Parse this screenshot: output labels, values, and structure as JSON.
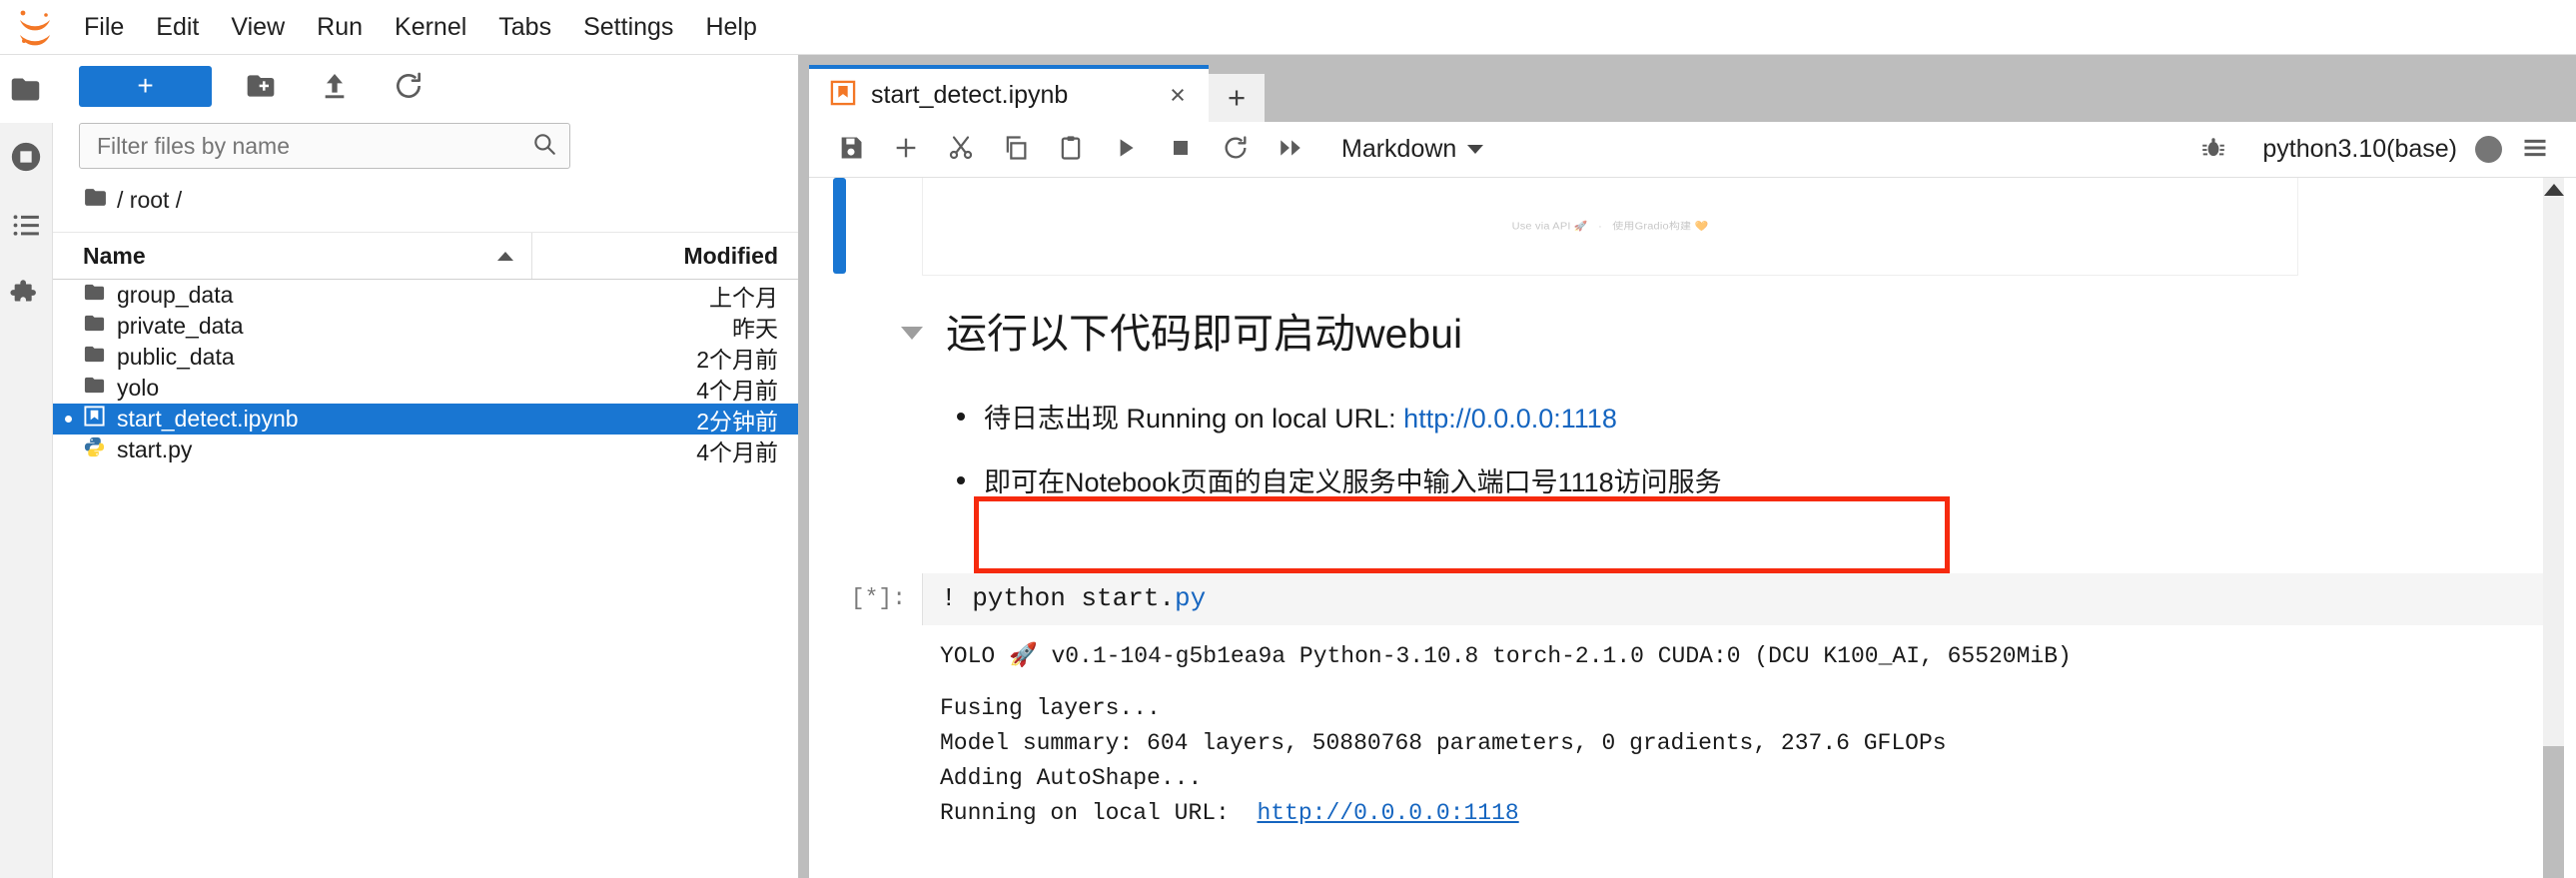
{
  "app": {
    "logo_icon": "jupyter-logo-icon",
    "menus": [
      "File",
      "Edit",
      "View",
      "Run",
      "Kernel",
      "Tabs",
      "Settings",
      "Help"
    ]
  },
  "activity_bar": {
    "items": [
      {
        "name": "file-browser",
        "icon": "folder-icon",
        "active": true
      },
      {
        "name": "running-sessions",
        "icon": "running-terminals-icon",
        "active": false
      },
      {
        "name": "table-of-contents",
        "icon": "list-icon",
        "active": false
      },
      {
        "name": "extension-manager",
        "icon": "puzzle-piece-icon",
        "active": false
      }
    ]
  },
  "file_browser": {
    "new_launcher_label": "+",
    "new_folder_icon": "new-folder-icon",
    "upload_icon": "upload-icon",
    "refresh_icon": "refresh-icon",
    "filter": {
      "value": "",
      "placeholder": "Filter files by name",
      "icon": "search-icon"
    },
    "breadcrumb": {
      "icon": "folder-icon",
      "path": "/ root /"
    },
    "columns": {
      "name": "Name",
      "modified": "Modified"
    },
    "sort": {
      "column": "Name",
      "direction": "ascending"
    },
    "rows": [
      {
        "name": "group_data",
        "modified": "上个月",
        "icon": "folder-icon",
        "selected": false
      },
      {
        "name": "private_data",
        "modified": "昨天",
        "icon": "folder-icon",
        "selected": false
      },
      {
        "name": "public_data",
        "modified": "2个月前",
        "icon": "folder-icon",
        "selected": false
      },
      {
        "name": "yolo",
        "modified": "4个月前",
        "icon": "folder-icon",
        "selected": false
      },
      {
        "name": "start_detect.ipynb",
        "modified": "2分钟前",
        "icon": "notebook-icon",
        "selected": true
      },
      {
        "name": "start.py",
        "modified": "4个月前",
        "icon": "python-icon",
        "selected": false
      }
    ]
  },
  "dock": {
    "tab": {
      "title": "start_detect.ipynb",
      "icon": "notebook-icon",
      "close_label": "×"
    },
    "add_tab_label": "+"
  },
  "notebook_toolbar": {
    "buttons": [
      {
        "name": "save-button",
        "icon": "save-icon"
      },
      {
        "name": "insert-cell-button",
        "icon": "plus-icon"
      },
      {
        "name": "cut-button",
        "icon": "scissors-icon"
      },
      {
        "name": "copy-button",
        "icon": "copy-icon"
      },
      {
        "name": "paste-button",
        "icon": "clipboard-icon"
      },
      {
        "name": "run-button",
        "icon": "play-icon"
      },
      {
        "name": "stop-button",
        "icon": "stop-square-icon"
      },
      {
        "name": "restart-button",
        "icon": "restart-icon"
      },
      {
        "name": "restart-run-all-button",
        "icon": "fast-forward-icon"
      }
    ],
    "cell_type": "Markdown",
    "debugger_icon": "bug-icon",
    "kernel_name": "python3.10(base)",
    "kernel_status": "busy",
    "menu_icon": "hamburger-icon"
  },
  "notebook": {
    "gradio_footer": {
      "api": "Use via API",
      "api_icon": "🚀",
      "separator": "·",
      "built_with": "使用Gradio构建",
      "heart_icon": "🧡"
    },
    "markdown_heading": "运行以下代码即可启动webui",
    "bullets": [
      {
        "text_before": "待日志出现 Running on local URL: ",
        "link": "http://0.0.0.0:1118",
        "text_after": ""
      },
      {
        "text_before": "即可在Notebook页面的自定义服务中输入端口号1118访问服务",
        "link": "",
        "text_after": ""
      }
    ],
    "annotation": {
      "color": "#f62a0e",
      "shape": "rectangle"
    },
    "code_cell": {
      "prompt": "[*]:",
      "source_prefix": "! python start.",
      "source_suffix": "py",
      "output_lines": [
        "YOLO 🚀 v0.1-104-g5b1ea9a Python-3.10.8 torch-2.1.0 CUDA:0 (DCU K100_AI, 65520MiB)",
        "",
        "Fusing layers...",
        "Model summary: 604 layers, 50880768 parameters, 0 gradients, 237.6 GFLOPs",
        "Adding AutoShape..."
      ],
      "final_line_prefix": "Running on local URL:  ",
      "final_line_link": "http://0.0.0.0:1118"
    },
    "scrollbar": {
      "up_icon": "caret-up-icon"
    }
  },
  "colors": {
    "accent": "#1976d2",
    "annotation": "#f62a0e",
    "link": "#1565c0",
    "jupyter_orange": "#f37726"
  }
}
